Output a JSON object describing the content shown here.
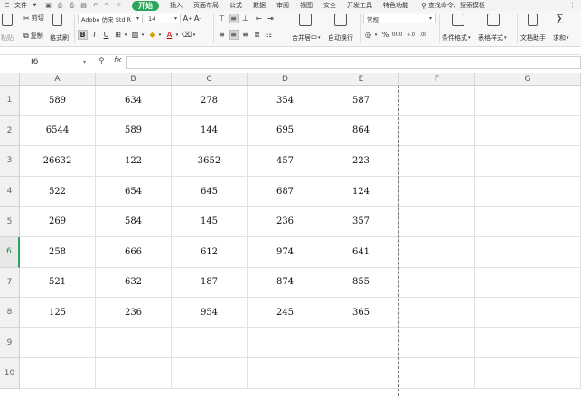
{
  "menubar": {
    "file_menu": "文件",
    "tabs": [
      "开始",
      "插入",
      "页面布局",
      "公式",
      "数据",
      "审阅",
      "视图",
      "安全",
      "开发工具",
      "特色功能"
    ],
    "search_placeholder": "查找命令、搜索模板"
  },
  "ribbon": {
    "cut": "剪切",
    "paste": "粘贴",
    "copy": "复制",
    "format_painter": "格式刷",
    "font_name": "Adobe 仿宋 Std R",
    "font_size": "14",
    "merge_center": "合并居中",
    "wrap_text": "自动换行",
    "number_format": "常规",
    "conditional_format": "条件格式",
    "table_style": "表格样式",
    "doc_assistant": "文档助手",
    "sum": "求和"
  },
  "formula_bar": {
    "cell_ref": "I6",
    "fx_label": "fx",
    "formula_value": ""
  },
  "sheet": {
    "columns": [
      "A",
      "B",
      "C",
      "D",
      "E",
      "F",
      "G"
    ],
    "rows": [
      "1",
      "2",
      "3",
      "4",
      "5",
      "6",
      "7",
      "8",
      "9",
      "10"
    ],
    "selected_row": "6",
    "cells": [
      [
        "589",
        "634",
        "278",
        "354",
        "587"
      ],
      [
        "6544",
        "589",
        "144",
        "695",
        "864"
      ],
      [
        "26632",
        "122",
        "3652",
        "457",
        "223"
      ],
      [
        "522",
        "654",
        "645",
        "687",
        "124"
      ],
      [
        "269",
        "584",
        "145",
        "236",
        "357"
      ],
      [
        "258",
        "666",
        "612",
        "974",
        "641"
      ],
      [
        "521",
        "632",
        "187",
        "874",
        "855"
      ],
      [
        "125",
        "236",
        "954",
        "245",
        "365"
      ],
      [
        "",
        "",
        "",
        "",
        ""
      ],
      [
        "",
        "",
        "",
        "",
        ""
      ]
    ]
  },
  "colors": {
    "accent_green": "#2aa55a",
    "header_bg": "#f1f1f1",
    "grid_line": "#e1e1e1"
  }
}
